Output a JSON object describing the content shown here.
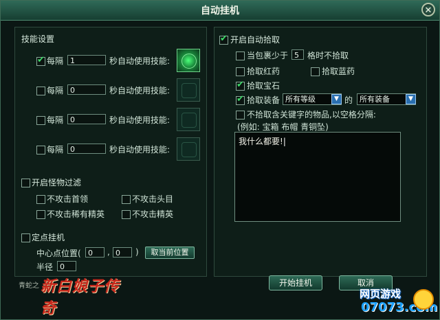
{
  "window": {
    "title": "自动挂机",
    "close_glyph": "✕"
  },
  "skills": {
    "section_title": "技能设置",
    "every_label": "每隔",
    "suffix_label": "秒自动使用技能:",
    "rows": [
      {
        "checked": true,
        "value": "1",
        "icon": "active-skill-icon"
      },
      {
        "checked": false,
        "value": "0",
        "icon": "empty-skill-slot-icon"
      },
      {
        "checked": false,
        "value": "0",
        "icon": "empty-skill-slot-icon"
      },
      {
        "checked": false,
        "value": "0",
        "icon": "empty-skill-slot-icon"
      }
    ]
  },
  "monster_filter": {
    "title": "开启怪物过滤",
    "enabled": false,
    "options": [
      {
        "label": "不攻击首领",
        "checked": false
      },
      {
        "label": "不攻击头目",
        "checked": false
      },
      {
        "label": "不攻击稀有精英",
        "checked": false
      },
      {
        "label": "不攻击精英",
        "checked": false
      }
    ]
  },
  "fixed_point": {
    "title": "定点挂机",
    "enabled": false,
    "center_label": "中心点位置(",
    "x": "0",
    "comma": ",",
    "y": "0",
    "close_paren": ")",
    "take_current_button": "取当前位置",
    "radius_label": "半径",
    "radius": "0"
  },
  "auto_pickup": {
    "title": "开启自动拾取",
    "enabled": true,
    "bag_prefix": "当包裹少于",
    "bag_value": "5",
    "bag_suffix": "格时不拾取",
    "bag_checked": false,
    "red_potion": {
      "label": "拾取红药",
      "checked": false
    },
    "blue_potion": {
      "label": "拾取蓝药",
      "checked": false
    },
    "gems": {
      "label": "拾取宝石",
      "checked": true
    },
    "equipment": {
      "label": "拾取装备",
      "checked": true,
      "level_select": "所有等级",
      "of_label": "的",
      "type_select": "所有装备"
    },
    "keyword": {
      "label": "不拾取含关键字的物品,以空格分隔:",
      "checked": false,
      "example": "(例如: 宝箱 布帽 青铜坠)",
      "text": "我什么都要!"
    }
  },
  "buttons": {
    "start": "开始挂机",
    "cancel": "取消"
  },
  "logo": {
    "small_text": "青蛇之",
    "brand": "新白娘子传奇"
  },
  "watermark": {
    "line1": "网页游戏",
    "line2": "07073.com"
  }
}
